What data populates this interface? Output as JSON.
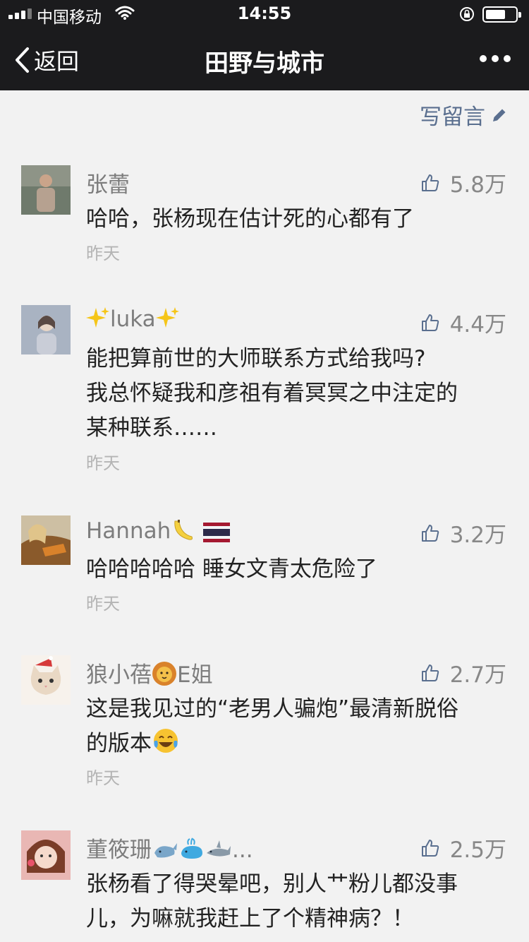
{
  "status_bar": {
    "carrier": "中国移动",
    "time": "14:55"
  },
  "nav": {
    "back_label": "返回",
    "title": "田野与城市"
  },
  "write_comment_label": "写留言",
  "comments": [
    {
      "nickname": "张蕾",
      "likes": "5.8万",
      "lines": [
        "哈哈，张杨现在估计死的心都有了"
      ],
      "time": "昨天"
    },
    {
      "nickname": "luka",
      "likes": "4.4万",
      "lines": [
        "能把算前世的大师联系方式给我吗?",
        "我总怀疑我和彦祖有着冥冥之中注定的",
        "某种联系……"
      ],
      "time": "昨天"
    },
    {
      "nickname": "Hannah",
      "likes": "3.2万",
      "lines": [
        "哈哈哈哈哈 睡女文青太危险了"
      ],
      "time": "昨天"
    },
    {
      "nickname_a": "狼小蓓",
      "nickname_b": "E姐",
      "likes": "2.7万",
      "lines": [
        "这是我见过的“老男人骗炮”最清新脱俗",
        "的版本"
      ],
      "time": "昨天"
    },
    {
      "nickname": "董筱珊",
      "nickname_tail": "...",
      "likes": "2.5万",
      "lines": [
        "张杨看了得哭晕吧，别人艹粉儿都没事",
        "儿，为嘛就我赶上了个精神病？！"
      ]
    }
  ],
  "colors": {
    "bar_bg": "#1b1b1d",
    "page_bg": "#f2f2f2",
    "link_blue": "#5a6f8f",
    "nickname_gray": "#7d7d7d",
    "time_gray": "#b4b4b4"
  }
}
